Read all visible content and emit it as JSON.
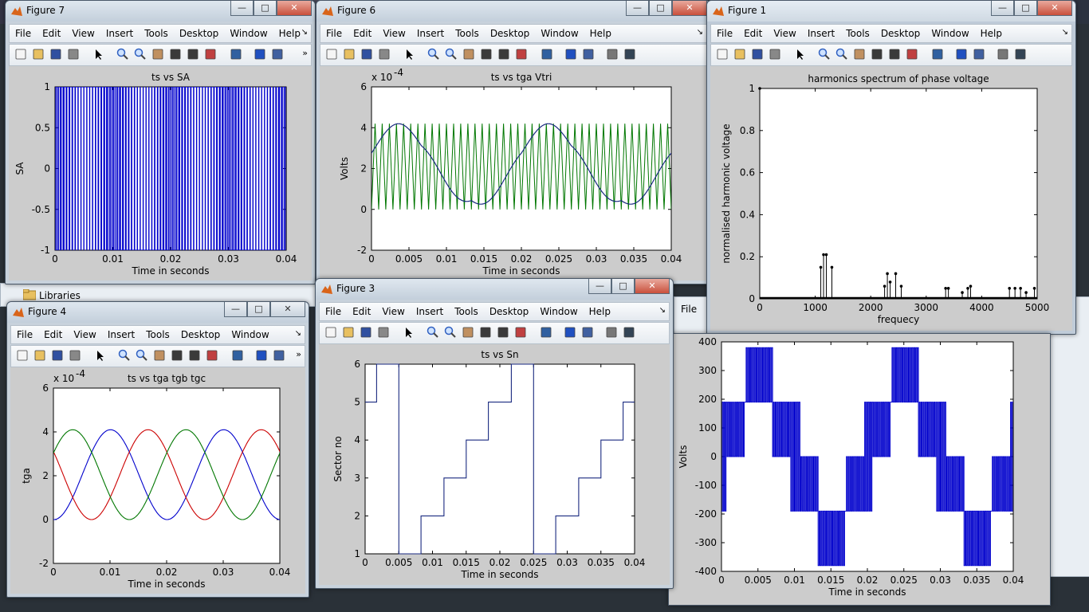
{
  "desktop": {
    "libraries_label": "Libraries",
    "file_label_partial": "File"
  },
  "menu_items": [
    "File",
    "Edit",
    "View",
    "Insert",
    "Tools",
    "Desktop",
    "Window",
    "Help"
  ],
  "fig7": {
    "title": "Figure 7",
    "axes_title": "ts vs SA",
    "xlabel": "Time in seconds",
    "ylabel": "SA",
    "xticks": [
      "0",
      "0.01",
      "0.02",
      "0.03",
      "0.04"
    ],
    "yticks": [
      "1",
      "0.5",
      "0",
      "-0.5",
      "-1"
    ]
  },
  "fig6": {
    "title": "Figure 6",
    "axes_title": "ts vs tga Vtri",
    "xlabel": "Time in seconds",
    "ylabel": "Volts",
    "exponent": "x 10",
    "exponent_power": "-4",
    "xticks": [
      "0",
      "0.005",
      "0.01",
      "0.015",
      "0.02",
      "0.025",
      "0.03",
      "0.035",
      "0.04"
    ],
    "yticks": [
      "6",
      "4",
      "2",
      "0",
      "-2"
    ]
  },
  "fig1": {
    "title": "Figure 1",
    "axes_title": "harmonics spectrum of phase voltage",
    "xlabel": "frequecy",
    "ylabel": "normalised harmonic voltage",
    "xticks": [
      "0",
      "1000",
      "2000",
      "3000",
      "4000",
      "5000"
    ],
    "yticks": [
      "1",
      "0.8",
      "0.6",
      "0.4",
      "0.2",
      "0"
    ]
  },
  "fig4": {
    "title": "Figure 4",
    "axes_title": "ts vs tga tgb tgc",
    "xlabel": "Time in seconds",
    "ylabel": "tga",
    "exponent": "x 10",
    "exponent_power": "-4",
    "xticks": [
      "0",
      "0.01",
      "0.02",
      "0.03",
      "0.04"
    ],
    "yticks": [
      "6",
      "4",
      "2",
      "0",
      "-2"
    ]
  },
  "fig3": {
    "title": "Figure 3",
    "axes_title": "ts vs Sn",
    "xlabel": "Time in seconds",
    "ylabel": "Sector no",
    "xticks": [
      "0",
      "0.005",
      "0.01",
      "0.015",
      "0.02",
      "0.025",
      "0.03",
      "0.035",
      "0.04"
    ],
    "yticks": [
      "6",
      "5",
      "4",
      "3",
      "2",
      "1"
    ]
  },
  "fig_phase": {
    "xlabel": "Time in seconds",
    "ylabel": "Volts",
    "xticks": [
      "0",
      "0.005",
      "0.01",
      "0.015",
      "0.02",
      "0.025",
      "0.03",
      "0.035",
      "0.04"
    ],
    "yticks": [
      "400",
      "300",
      "200",
      "100",
      "0",
      "-100",
      "-200",
      "-300",
      "-400"
    ]
  },
  "colors": {
    "blue": "#0000cc",
    "green": "#007700",
    "red": "#cc0000",
    "navy": "#1a2a80"
  },
  "chart_data": [
    {
      "id": "fig7",
      "type": "line",
      "title": "ts vs SA",
      "xlabel": "Time in seconds",
      "ylabel": "SA",
      "xlim": [
        0,
        0.04
      ],
      "ylim": [
        -1,
        1
      ],
      "description_series": [
        {
          "values_note": "switching signal between -1 and 1"
        }
      ]
    },
    {
      "id": "fig6",
      "type": "line",
      "title": "ts vs tga Vtri",
      "xlabel": "Time in seconds",
      "ylabel": "Volts",
      "xlim": [
        0,
        0.04
      ],
      "ylim": [
        -2,
        6
      ],
      "y_scale_exponent": -4,
      "series": [
        {
          "values_note": "triangular carrier 0 to 4.2"
        },
        {
          "values_note": "tga periodic 0 to 4.2"
        }
      ]
    },
    {
      "id": "fig1",
      "type": "bar",
      "title": "harmonics spectrum of phase voltage",
      "xlabel": "frequecy",
      "ylabel": "normalised harmonic voltage",
      "xlim": [
        0,
        5000
      ],
      "ylim": [
        0,
        1
      ],
      "x": [
        0,
        1100,
        1150,
        1200,
        1300,
        2250,
        2300,
        2350,
        2450,
        2550,
        3350,
        3400,
        3650,
        3750,
        3800,
        4500,
        4600,
        4700,
        4800,
        4950
      ],
      "values": [
        1,
        0.15,
        0.21,
        0.21,
        0.15,
        0.06,
        0.12,
        0.08,
        0.12,
        0.06,
        0.05,
        0.05,
        0.03,
        0.05,
        0.06,
        0.05,
        0.05,
        0.05,
        0.03,
        0.05
      ]
    },
    {
      "id": "fig4",
      "type": "line",
      "title": "ts vs tga tgb tgc",
      "xlabel": "Time in seconds",
      "ylabel": "tga",
      "xlim": [
        0,
        0.04
      ],
      "ylim": [
        -2,
        6
      ],
      "y_scale_exponent": -4,
      "series": [
        {
          "values_note": "tga",
          "color": "#0000cc"
        },
        {
          "values_note": "tgb",
          "color": "#cc0000"
        },
        {
          "values_note": "tgc",
          "color": "#007700"
        }
      ]
    },
    {
      "id": "fig3",
      "type": "line",
      "title": "ts vs Sn",
      "xlabel": "Time in seconds",
      "ylabel": "Sector no",
      "xlim": [
        0,
        0.04
      ],
      "ylim": [
        1,
        6
      ],
      "x": [
        0,
        0.0017,
        0.0017,
        0.005,
        0.005,
        0.0083,
        0.0083,
        0.0117,
        0.0117,
        0.015,
        0.015,
        0.0183,
        0.0183,
        0.0217,
        0.0217,
        0.025,
        0.025,
        0.0283,
        0.0283,
        0.0317,
        0.0317,
        0.035,
        0.035,
        0.0383,
        0.0383,
        0.04
      ],
      "values": [
        5,
        5,
        6,
        6,
        1,
        1,
        2,
        2,
        3,
        3,
        4,
        4,
        5,
        5,
        6,
        6,
        1,
        1,
        2,
        2,
        3,
        3,
        4,
        4,
        5,
        5
      ]
    },
    {
      "id": "fig_phase",
      "type": "line",
      "xlabel": "Time in seconds",
      "ylabel": "Volts",
      "xlim": [
        0,
        0.04
      ],
      "ylim": [
        -400,
        400
      ],
      "levels": [
        -380,
        -190,
        0,
        190,
        380
      ]
    }
  ]
}
